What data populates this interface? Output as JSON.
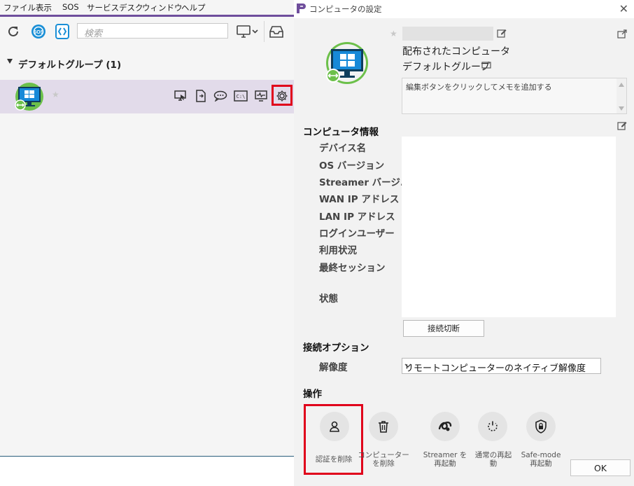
{
  "menubar": {
    "items": [
      "ファイル",
      "表示",
      "SOS",
      "サービスデスク",
      "ウィンドウ",
      "ヘルプ"
    ]
  },
  "toolbar": {
    "search_placeholder": "検索",
    "icons": [
      "refresh-icon",
      "sos-icon",
      "remote-app-icon",
      "monitor-dropdown-icon",
      "inbox-icon"
    ]
  },
  "group": {
    "label": "デフォルトグループ (1)"
  },
  "row": {
    "icons": [
      "remote-screen-icon",
      "file-transfer-icon",
      "chat-icon",
      "terminal-icon",
      "monitor-pulse-icon",
      "settings-gear-icon"
    ]
  },
  "dialog": {
    "title": "コンピュータの設定",
    "distributed_label": "配布されたコンピュータ",
    "group_name": "デフォルトグループ",
    "memo_placeholder": "編集ボタンをクリックしてメモを追加する",
    "info_section": {
      "title": "コンピュータ情報",
      "labels": [
        "デバイス名",
        "OS バージョン",
        "Streamer バージ...",
        "WAN IP アドレス",
        "LAN IP アドレス",
        "ログインユーザー",
        "利用状況",
        "最終セッション",
        "状態"
      ]
    },
    "disconnect_label": "接続切断",
    "connection_section": {
      "title": "接続オプション",
      "resolution_label": "解像度",
      "resolution_value": "リモートコンピューターのネイティブ解像度"
    },
    "operations": {
      "title": "操作",
      "items": [
        {
          "line1": "認証を削除",
          "line2": ""
        },
        {
          "line1": "コンピューター",
          "line2": "を削除"
        },
        {
          "line1": "Streamer を",
          "line2": "再起動"
        },
        {
          "line1": "通常の再起",
          "line2": "動"
        },
        {
          "line1": "Safe-mode",
          "line2": "再起動"
        }
      ]
    },
    "ok_label": "OK"
  },
  "colors": {
    "accent_purple": "#6f4e9c",
    "highlight_red": "#e0001b",
    "selected_row": "#e2dbea"
  }
}
